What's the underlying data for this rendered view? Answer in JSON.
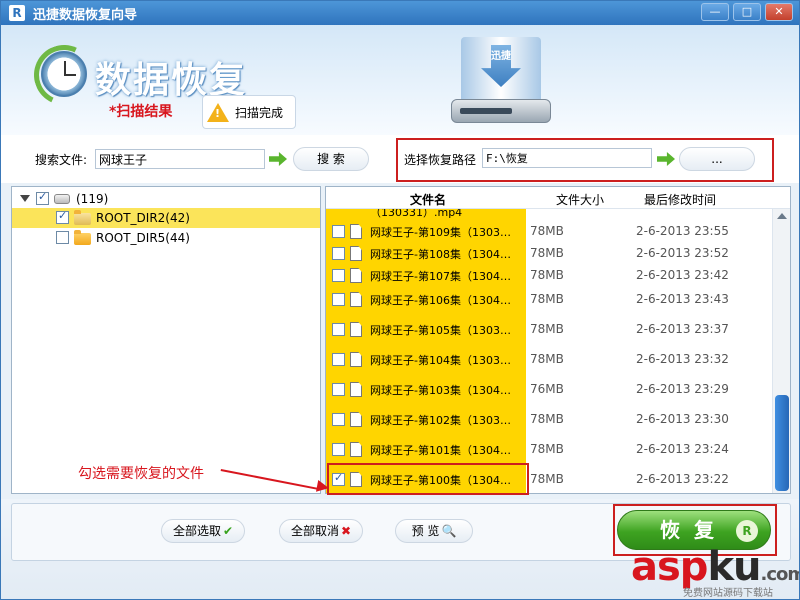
{
  "window": {
    "title": "迅捷数据恢复向导",
    "app_icon": "R",
    "minimize_label": "—",
    "maximize_label": "□",
    "close_label": "✕"
  },
  "header": {
    "title": "数据恢复",
    "scan_result_label": "*扫描结果",
    "scan_status": "扫描完成",
    "drive_label": "迅捷"
  },
  "search": {
    "label": "搜索文件:",
    "value": "网球王子",
    "button_label": "搜 索"
  },
  "recover_path": {
    "label": "选择恢复路径",
    "value": "F:\\恢复",
    "browse_label": "..."
  },
  "tree": {
    "root": {
      "label": "(119)",
      "checked": true
    },
    "items": [
      {
        "label": "ROOT_DIR2(42)",
        "checked": true,
        "selected": true
      },
      {
        "label": "ROOT_DIR5(44)",
        "checked": false,
        "selected": false
      }
    ]
  },
  "file_list": {
    "columns": {
      "name": "文件名",
      "size": "文件大小",
      "modified": "最后修改时间"
    },
    "partial_row": {
      "name": "（130331）.mp4"
    },
    "rows": [
      {
        "name": "网球王子-第109集（1303…",
        "size": "78MB",
        "modified": "2-6-2013 23:55",
        "checked": false
      },
      {
        "name": "网球王子-第108集（1304…",
        "size": "78MB",
        "modified": "2-6-2013 23:52",
        "checked": false
      },
      {
        "name": "网球王子-第107集（1304…",
        "size": "78MB",
        "modified": "2-6-2013 23:42",
        "checked": false
      },
      {
        "name": "网球王子-第106集（1304…",
        "size": "78MB",
        "modified": "2-6-2013 23:43",
        "checked": false
      },
      {
        "name": "网球王子-第105集（1303…",
        "size": "78MB",
        "modified": "2-6-2013 23:37",
        "checked": false
      },
      {
        "name": "网球王子-第104集（1303…",
        "size": "78MB",
        "modified": "2-6-2013 23:32",
        "checked": false
      },
      {
        "name": "网球王子-第103集（1304…",
        "size": "76MB",
        "modified": "2-6-2013 23:29",
        "checked": false
      },
      {
        "name": "网球王子-第102集（1303…",
        "size": "78MB",
        "modified": "2-6-2013 23:30",
        "checked": false
      },
      {
        "name": "网球王子-第101集（1304…",
        "size": "78MB",
        "modified": "2-6-2013 23:24",
        "checked": false
      },
      {
        "name": "网球王子-第100集（1304…",
        "size": "78MB",
        "modified": "2-6-2013 23:22",
        "checked": true
      }
    ]
  },
  "annotation": "勾选需要恢复的文件",
  "buttons": {
    "select_all": "全部选取",
    "deselect_all": "全部取消",
    "preview": "预 览",
    "recover": "恢复"
  },
  "watermark": {
    "main_red": "asp",
    "main_dark": "ku",
    "suffix": ".com",
    "subtitle": "免费网站源码下载站"
  },
  "colors": {
    "accent_blue": "#2f74bd",
    "highlight_yellow": "#ffd500",
    "annotation_red": "#d8161e",
    "recover_green": "#3ea321"
  }
}
